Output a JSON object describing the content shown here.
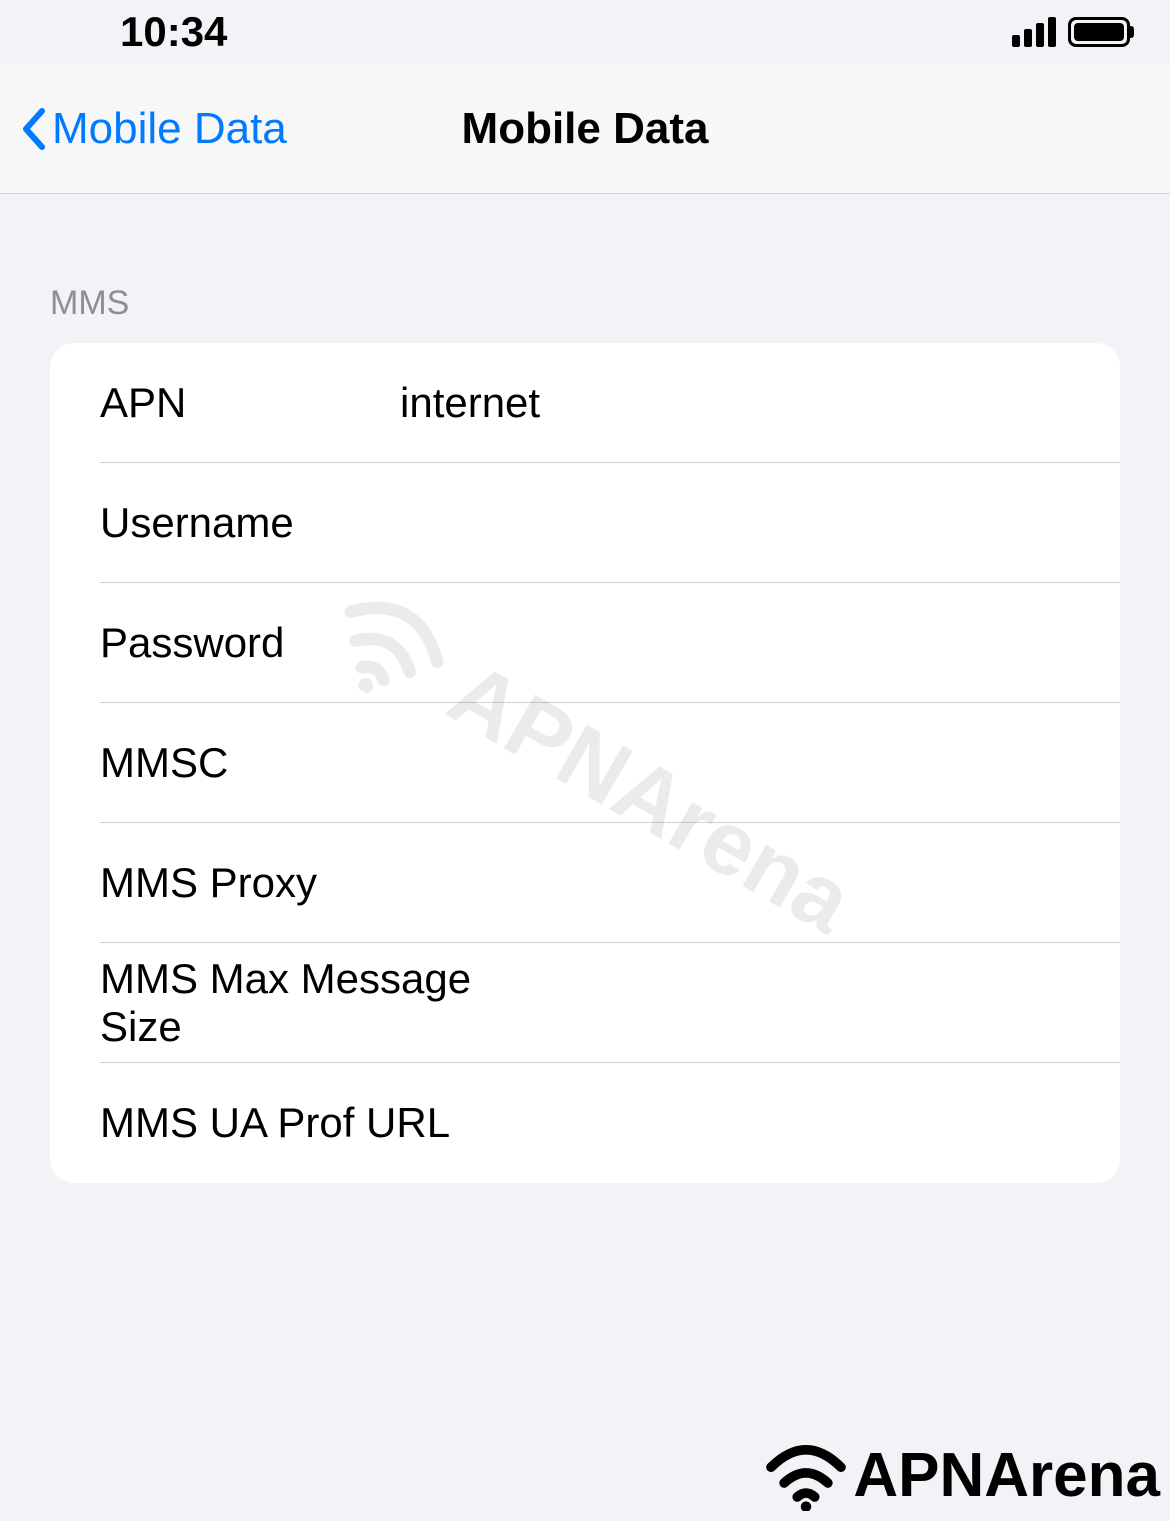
{
  "status": {
    "time": "10:34"
  },
  "nav": {
    "back_label": "Mobile Data",
    "title": "Mobile Data"
  },
  "section": {
    "header": "MMS"
  },
  "fields": {
    "apn": {
      "label": "APN",
      "value": "internet"
    },
    "username": {
      "label": "Username",
      "value": ""
    },
    "password": {
      "label": "Password",
      "value": ""
    },
    "mmsc": {
      "label": "MMSC",
      "value": ""
    },
    "mms_proxy": {
      "label": "MMS Proxy",
      "value": ""
    },
    "mms_max_size": {
      "label": "MMS Max Message Size",
      "value": ""
    },
    "mms_ua_prof": {
      "label": "MMS UA Prof URL",
      "value": ""
    }
  },
  "watermark": {
    "text": "APNArena"
  },
  "footer": {
    "text": "APNArena"
  }
}
